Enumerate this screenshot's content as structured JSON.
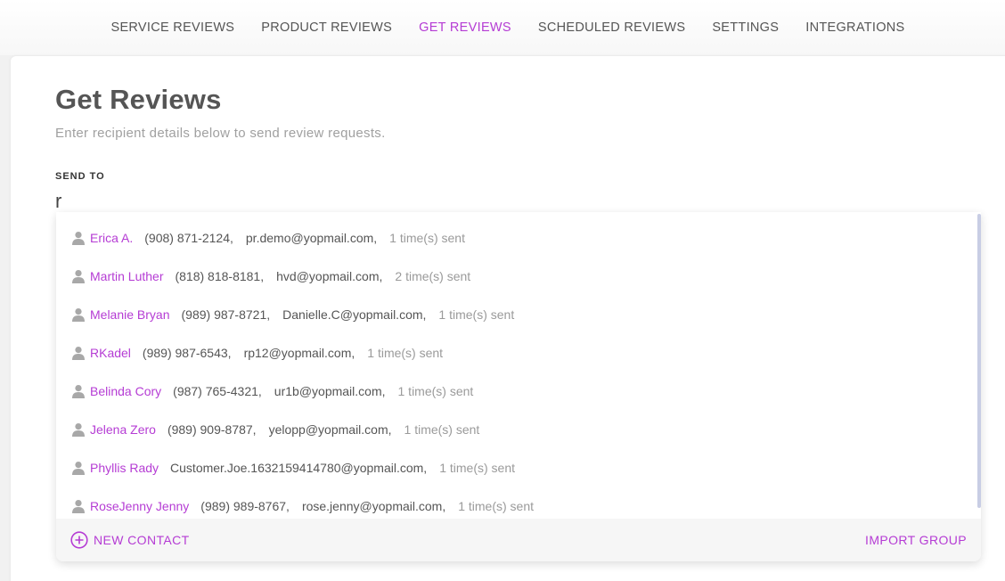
{
  "nav": {
    "items": [
      {
        "label": "SERVICE REVIEWS",
        "active": false
      },
      {
        "label": "PRODUCT REVIEWS",
        "active": false
      },
      {
        "label": "GET REVIEWS",
        "active": true
      },
      {
        "label": "SCHEDULED REVIEWS",
        "active": false
      },
      {
        "label": "SETTINGS",
        "active": false
      },
      {
        "label": "INTEGRATIONS",
        "active": false
      }
    ]
  },
  "page": {
    "title": "Get Reviews",
    "subtitle": "Enter recipient details below to send review requests."
  },
  "send_to": {
    "label": "SEND TO",
    "value": "r"
  },
  "results": [
    {
      "name": "Erica A.",
      "phone": "(908) 871-2124,",
      "email": "pr.demo@yopmail.com,",
      "sent": "1 time(s) sent"
    },
    {
      "name": "Martin Luther",
      "phone": "(818) 818-8181,",
      "email": "hvd@yopmail.com,",
      "sent": "2 time(s) sent"
    },
    {
      "name": "Melanie Bryan",
      "phone": "(989) 987-8721,",
      "email": "Danielle.C@yopmail.com,",
      "sent": "1 time(s) sent"
    },
    {
      "name": "RKadel",
      "phone": "(989) 987-6543,",
      "email": "rp12@yopmail.com,",
      "sent": "1 time(s) sent"
    },
    {
      "name": "Belinda Cory",
      "phone": "(987) 765-4321,",
      "email": "ur1b@yopmail.com,",
      "sent": "1 time(s) sent"
    },
    {
      "name": "Jelena Zero",
      "phone": "(989) 909-8787,",
      "email": "yelopp@yopmail.com,",
      "sent": "1 time(s) sent"
    },
    {
      "name": "Phyllis Rady",
      "phone": "",
      "email": "Customer.Joe.1632159414780@yopmail.com,",
      "sent": "1 time(s) sent"
    },
    {
      "name": "RoseJenny Jenny",
      "phone": "(989) 989-8767,",
      "email": "rose.jenny@yopmail.com,",
      "sent": "1 time(s) sent"
    }
  ],
  "footer": {
    "new_contact_label": "NEW CONTACT",
    "import_group_label": "IMPORT GROUP"
  },
  "icons": {
    "person": "person-icon",
    "add": "plus-circle-icon"
  },
  "colors": {
    "accent": "#b53cd4",
    "text": "#555555",
    "muted": "#9a9a9a"
  }
}
